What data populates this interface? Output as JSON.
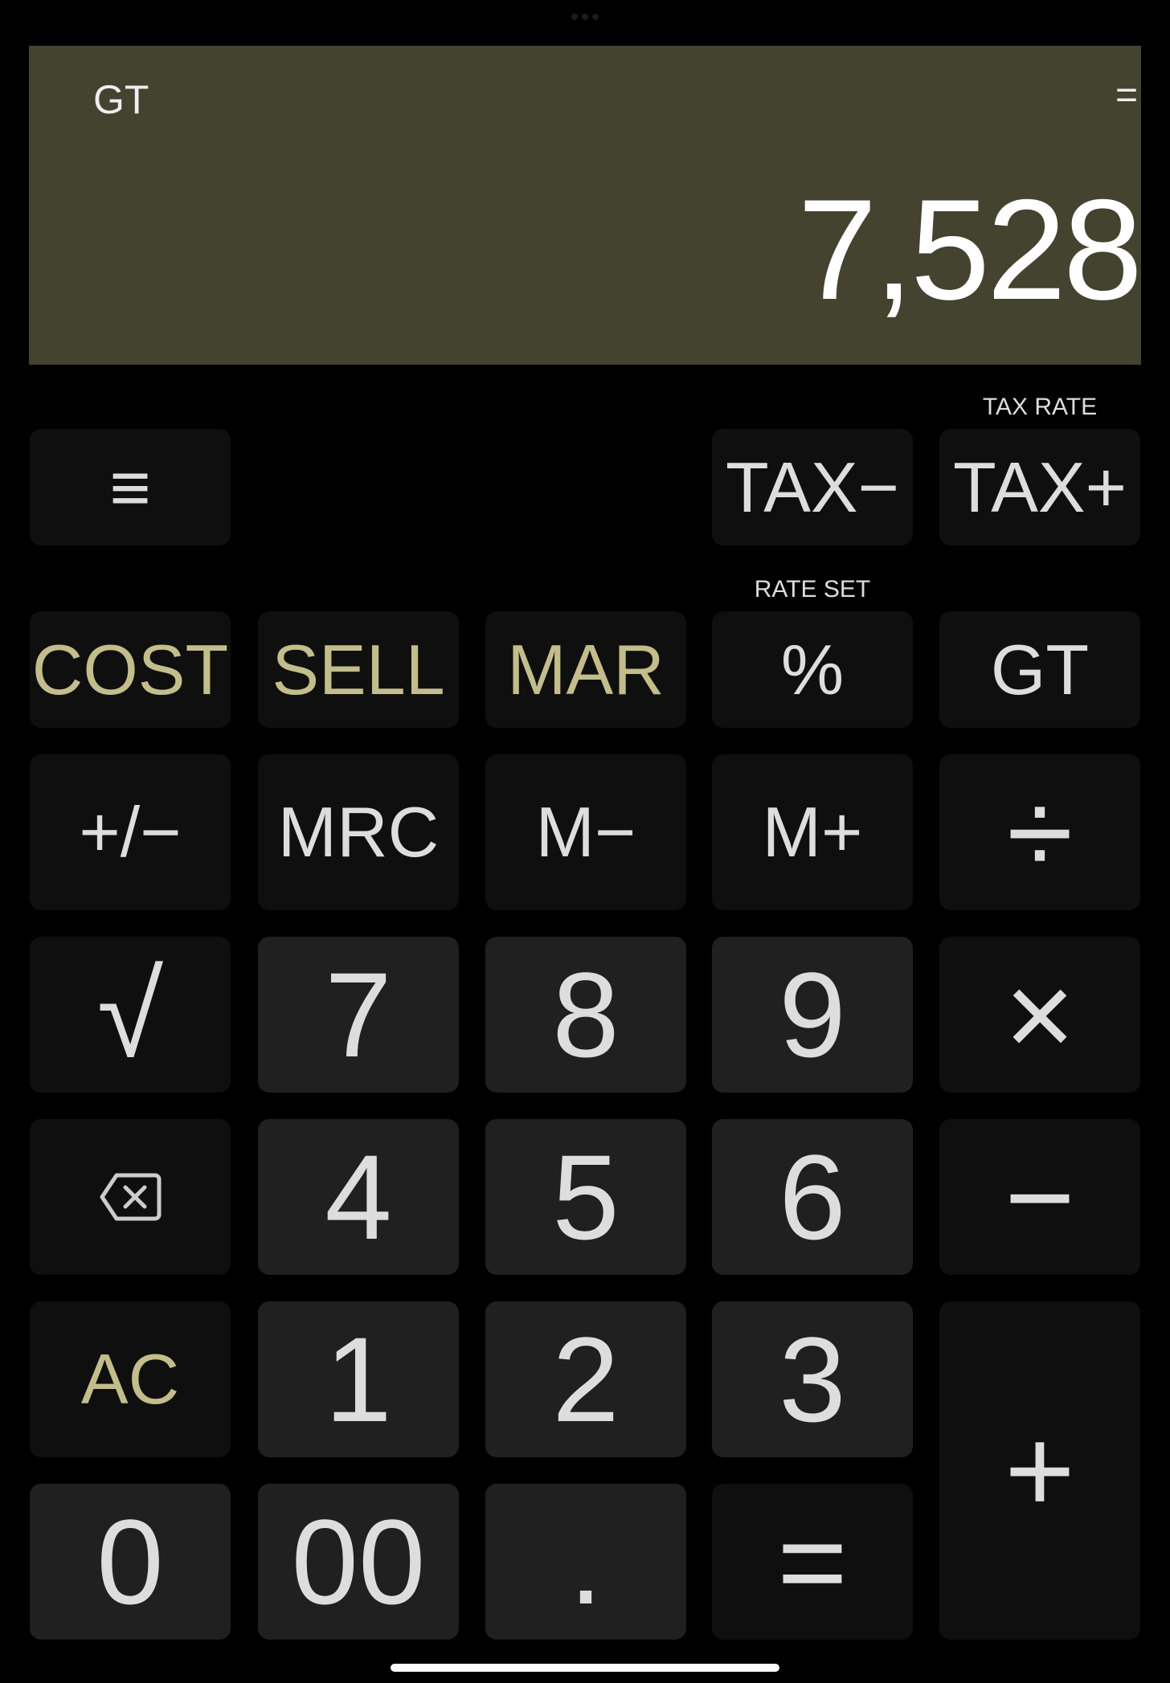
{
  "display": {
    "indicator_left": "GT",
    "indicator_right": "=",
    "value": "7,528",
    "background": "#434330"
  },
  "labels": {
    "tax_rate": "TAX RATE",
    "rate_set": "RATE SET"
  },
  "keys": {
    "menu": "≡",
    "tax_minus": "TAX−",
    "tax_plus": "TAX+",
    "cost": "COST",
    "sell": "SELL",
    "mar": "MAR",
    "percent": "%",
    "gt": "GT",
    "sign": "+/−",
    "mrc": "MRC",
    "m_minus": "M−",
    "m_plus": "M+",
    "divide": "÷",
    "sqrt": "√",
    "seven": "7",
    "eight": "8",
    "nine": "9",
    "multiply": "×",
    "four": "4",
    "five": "5",
    "six": "6",
    "minus": "−",
    "ac": "AC",
    "one": "1",
    "two": "2",
    "three": "3",
    "plus": "+",
    "zero": "0",
    "double_zero": "00",
    "decimal": ".",
    "equals": "="
  },
  "colors": {
    "accent_gold": "#c2bd8a",
    "function_key": "#0f0f0f",
    "digit_key": "#202020"
  }
}
